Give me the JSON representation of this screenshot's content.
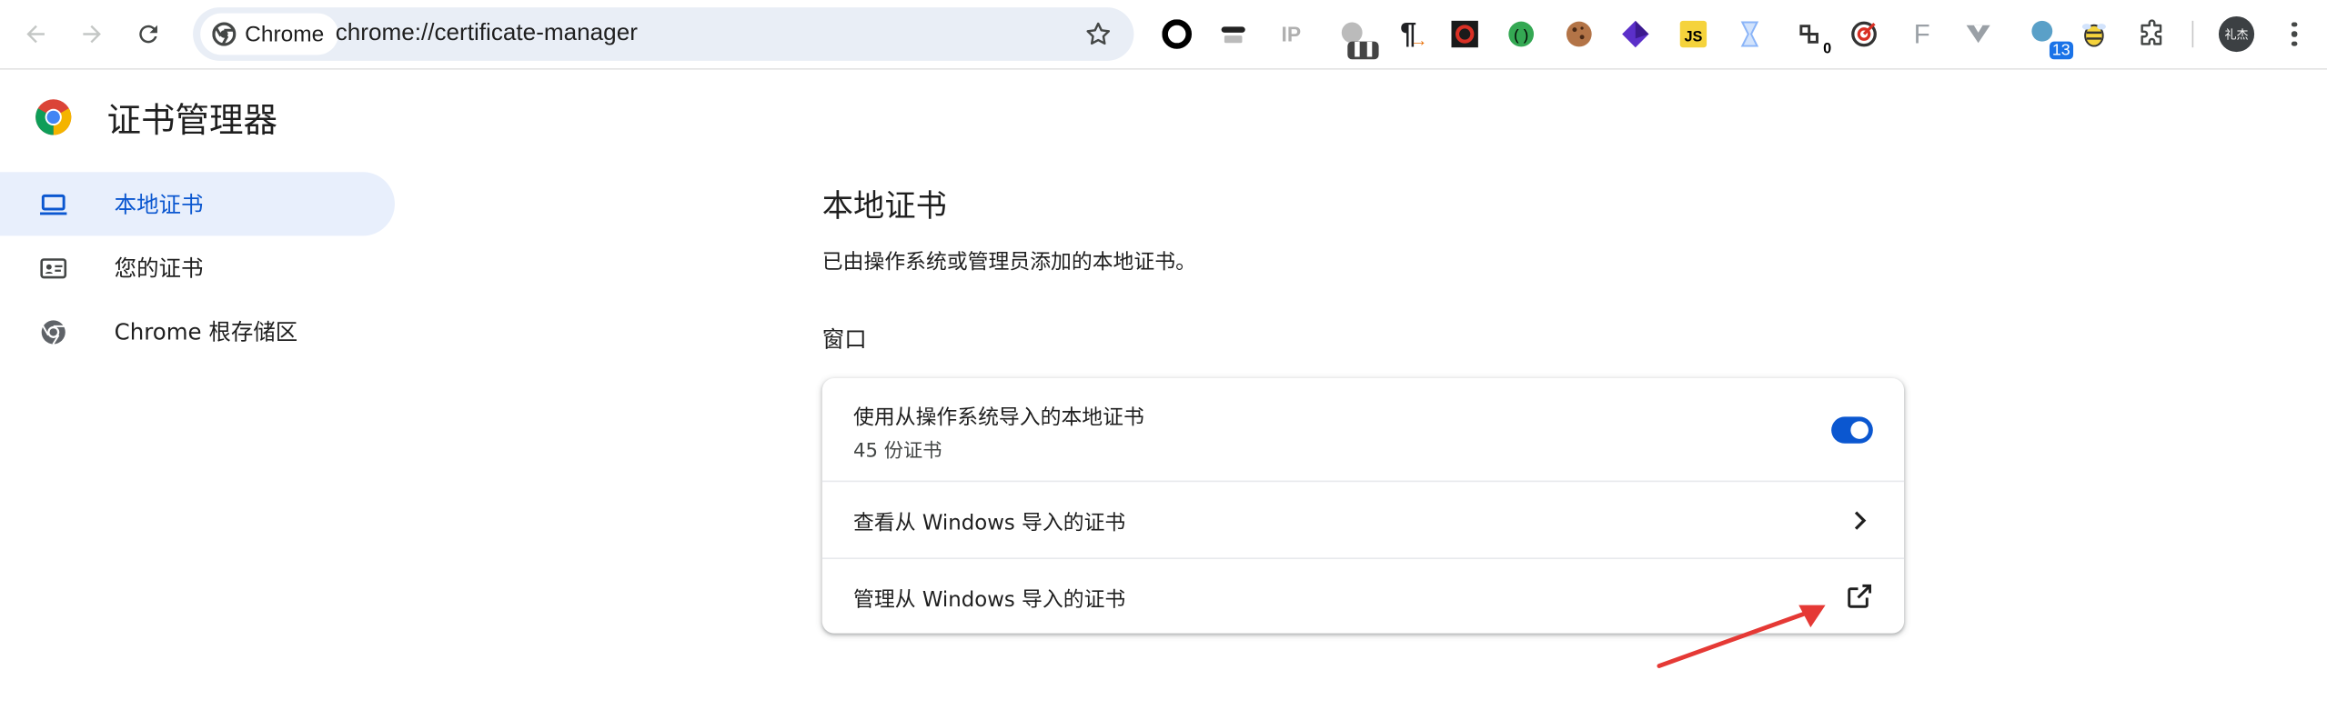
{
  "browser": {
    "chip_label": "Chrome",
    "url": "chrome://certificate-manager",
    "extensions": [
      {
        "name": "circle-extension-icon",
        "glyph": "",
        "color": "#000000"
      },
      {
        "name": "mask-extension-icon",
        "glyph": "",
        "color": "#444444"
      },
      {
        "name": "ip-extension-icon",
        "glyph": "IP",
        "color": "#b0b0b0"
      },
      {
        "name": "pause-extension-icon",
        "glyph": "",
        "color": "#888888"
      },
      {
        "name": "pilcrow-extension-icon",
        "glyph": "¶",
        "color": "#202124"
      },
      {
        "name": "red-box-extension-icon",
        "glyph": "",
        "color": "#d93025"
      },
      {
        "name": "green-circle-extension-icon",
        "glyph": "",
        "color": "#34a853"
      },
      {
        "name": "cookie-extension-icon",
        "glyph": "",
        "color": "#8d5a3b"
      },
      {
        "name": "purple-cube-extension-icon",
        "glyph": "",
        "color": "#5b2fc9"
      },
      {
        "name": "js-extension-icon",
        "glyph": "JS",
        "color": "#f5d33c"
      },
      {
        "name": "hourglass-extension-icon",
        "glyph": "",
        "color": "#8ab4f8"
      },
      {
        "name": "counter-extension-icon",
        "glyph": "",
        "color": "#333333"
      },
      {
        "name": "target-extension-icon",
        "glyph": "",
        "color": "#d93025"
      },
      {
        "name": "f-extension-icon",
        "glyph": "F",
        "color": "#9aa0a6"
      },
      {
        "name": "v-extension-icon",
        "glyph": "",
        "color": "#9aa0a6"
      },
      {
        "name": "badge-extension-icon",
        "glyph": "",
        "color": "#5aa0c8"
      },
      {
        "name": "bee-extension-icon",
        "glyph": "",
        "color": "#c9a227"
      },
      {
        "name": "puzzle-extensions-icon",
        "glyph": "",
        "color": "#444746"
      }
    ],
    "badges": {
      "pause": "",
      "counter": "0",
      "blue": "13"
    },
    "avatar_text": "礼杰"
  },
  "page": {
    "title": "证书管理器"
  },
  "sidebar": {
    "items": [
      {
        "label": "本地证书",
        "icon": "laptop-icon",
        "active": true
      },
      {
        "label": "您的证书",
        "icon": "id-card-icon",
        "active": false
      },
      {
        "label": "Chrome 根存储区",
        "icon": "chrome-icon",
        "active": false
      }
    ]
  },
  "main": {
    "section_title": "本地证书",
    "section_description": "已由操作系统或管理员添加的本地证书。",
    "subheading": "窗口",
    "rows": [
      {
        "label": "使用从操作系统导入的本地证书",
        "sublabel": "45 份证书",
        "control": "toggle",
        "enabled": true
      },
      {
        "label": "查看从 Windows 导入的证书",
        "control": "chevron"
      },
      {
        "label": "管理从 Windows 导入的证书",
        "control": "external-link"
      }
    ]
  },
  "colors": {
    "accent": "#0b57d0",
    "active_bg": "#e8effc",
    "annotation_arrow": "#e53935"
  }
}
